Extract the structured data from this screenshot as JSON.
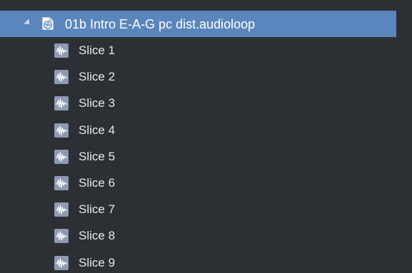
{
  "tree": {
    "parent": {
      "label": "01b Intro E-A-G pc dist.audioloop",
      "expanded": true,
      "icon": "audioloop-file-icon"
    },
    "children": [
      {
        "label": "Slice 1",
        "icon": "waveform-icon"
      },
      {
        "label": "Slice 2",
        "icon": "waveform-icon"
      },
      {
        "label": "Slice 3",
        "icon": "waveform-icon"
      },
      {
        "label": "Slice 4",
        "icon": "waveform-icon"
      },
      {
        "label": "Slice 5",
        "icon": "waveform-icon"
      },
      {
        "label": "Slice 6",
        "icon": "waveform-icon"
      },
      {
        "label": "Slice 7",
        "icon": "waveform-icon"
      },
      {
        "label": "Slice 8",
        "icon": "waveform-icon"
      },
      {
        "label": "Slice 9",
        "icon": "waveform-icon"
      }
    ]
  },
  "colors": {
    "background": "#2c2f33",
    "selected_row": "#5b86bd",
    "slice_icon_bg": "#8e9ab2",
    "text": "#e6e9ee"
  }
}
